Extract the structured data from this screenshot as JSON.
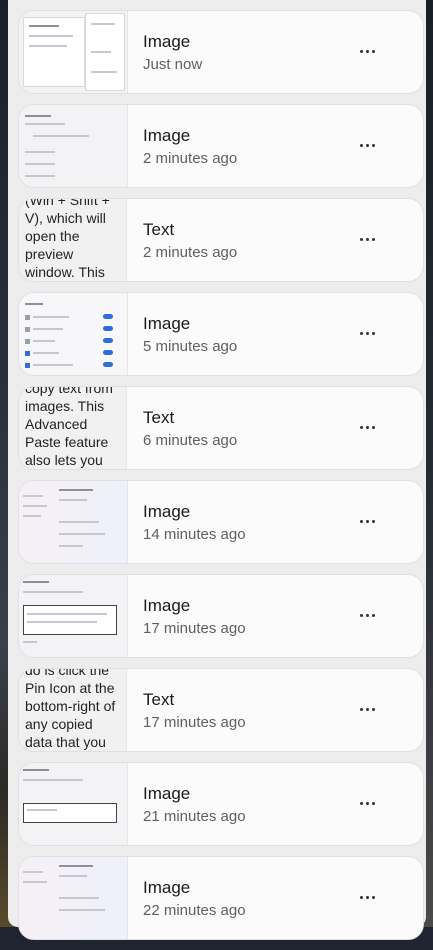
{
  "clipboard": {
    "items": [
      {
        "type": "Image",
        "time": "Just now",
        "thumb": "image",
        "menu_icon": "more-icon"
      },
      {
        "type": "Image",
        "time": "2 minutes ago",
        "thumb": "image"
      },
      {
        "type": "Text",
        "time": "2 minutes ago",
        "thumb": "text",
        "preview": "(Win + Shift + V), which will open the preview window. This shortcut"
      },
      {
        "type": "Image",
        "time": "5 minutes ago",
        "thumb": "image"
      },
      {
        "type": "Text",
        "time": "6 minutes ago",
        "thumb": "text",
        "preview": "copy text from images. This Advanced Paste feature also lets you"
      },
      {
        "type": "Image",
        "time": "14 minutes ago",
        "thumb": "image"
      },
      {
        "type": "Image",
        "time": "17 minutes ago",
        "thumb": "image"
      },
      {
        "type": "Text",
        "time": "17 minutes ago",
        "thumb": "text",
        "preview": "do is click the Pin Icon at the bottom-right of any copied data that you want to keep"
      },
      {
        "type": "Image",
        "time": "21 minutes ago",
        "thumb": "image"
      },
      {
        "type": "Image",
        "time": "22 minutes ago",
        "thumb": "image"
      }
    ]
  }
}
